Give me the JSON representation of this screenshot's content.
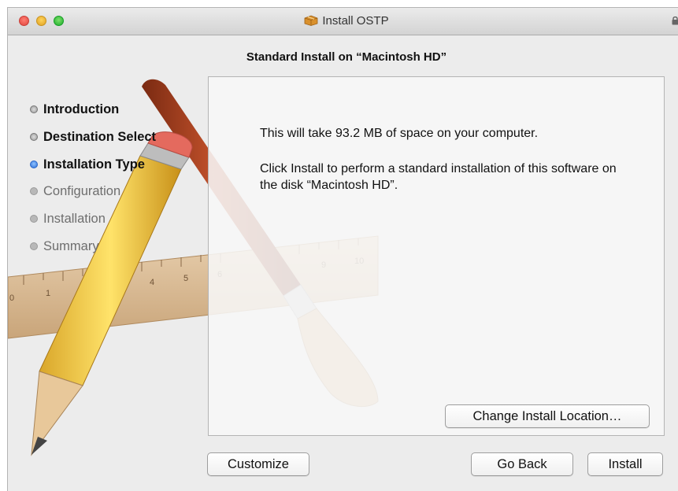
{
  "window": {
    "title": "Install OSTP"
  },
  "heading": "Standard Install on “Macintosh HD”",
  "steps": [
    {
      "label": "Introduction",
      "state": "done"
    },
    {
      "label": "Destination Select",
      "state": "done"
    },
    {
      "label": "Installation Type",
      "state": "current"
    },
    {
      "label": "Configuration",
      "state": "pending"
    },
    {
      "label": "Installation",
      "state": "pending"
    },
    {
      "label": "Summary",
      "state": "pending"
    }
  ],
  "panel": {
    "space_message": "This will take 93.2 MB of space on your computer.",
    "install_message": "Click Install to perform a standard installation of this software on the disk “Macintosh HD”.",
    "change_location_label": "Change Install Location…"
  },
  "buttons": {
    "customize": "Customize",
    "go_back": "Go Back",
    "install": "Install"
  },
  "ruler_numbers": [
    "0",
    "1",
    "4",
    "5",
    "6",
    "9",
    "10"
  ],
  "colors": {
    "current_step": "#2d6fd8",
    "pending_text": "#6e6e6e"
  }
}
